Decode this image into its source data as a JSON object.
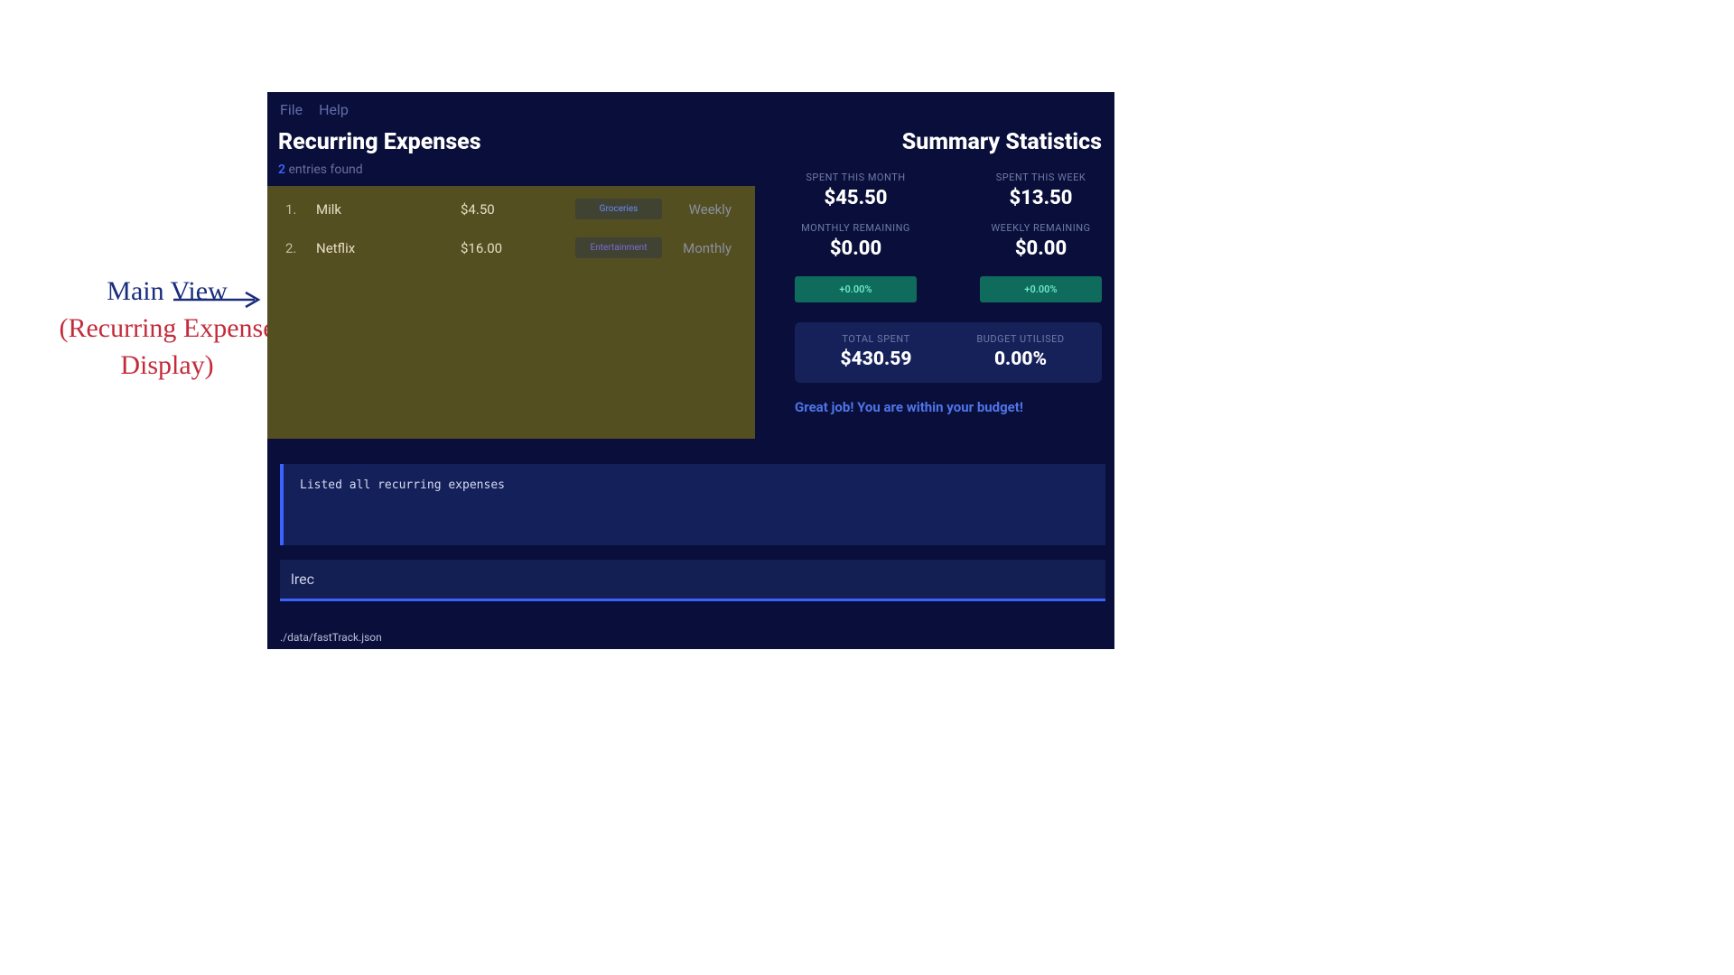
{
  "annotation": {
    "line1": "Main View",
    "sub1": "(Recurring Expense",
    "sub2": "Display)"
  },
  "menu": {
    "file": "File",
    "help": "Help"
  },
  "left": {
    "title": "Recurring Expenses",
    "entries_count_num": "2",
    "entries_count_text": " entries found",
    "rows": [
      {
        "index": "1.",
        "name": "Milk",
        "amount": "$4.50",
        "category": "Groceries",
        "freq": "Weekly"
      },
      {
        "index": "2.",
        "name": "Netflix",
        "amount": "$16.00",
        "category": "Entertainment",
        "freq": "Monthly"
      }
    ]
  },
  "right": {
    "title": "Summary Statistics",
    "spent_month_label": "SPENT THIS MONTH",
    "spent_month_value": "$45.50",
    "spent_week_label": "SPENT THIS WEEK",
    "spent_week_value": "$13.50",
    "month_remaining_label": "MONTHLY REMAINING",
    "month_remaining_value": "$0.00",
    "week_remaining_label": "WEEKLY REMAINING",
    "week_remaining_value": "$0.00",
    "month_pct": "+0.00%",
    "week_pct": "+0.00%",
    "total_spent_label": "TOTAL SPENT",
    "total_spent_value": "$430.59",
    "budget_utilised_label": "BUDGET UTILISED",
    "budget_utilised_value": "0.00%",
    "budget_msg": "Great job! You are within your budget!"
  },
  "log": {
    "line1": "Listed all recurring expenses"
  },
  "cmd": {
    "value": "lrec"
  },
  "footer": {
    "path": "./data/fastTrack.json"
  }
}
